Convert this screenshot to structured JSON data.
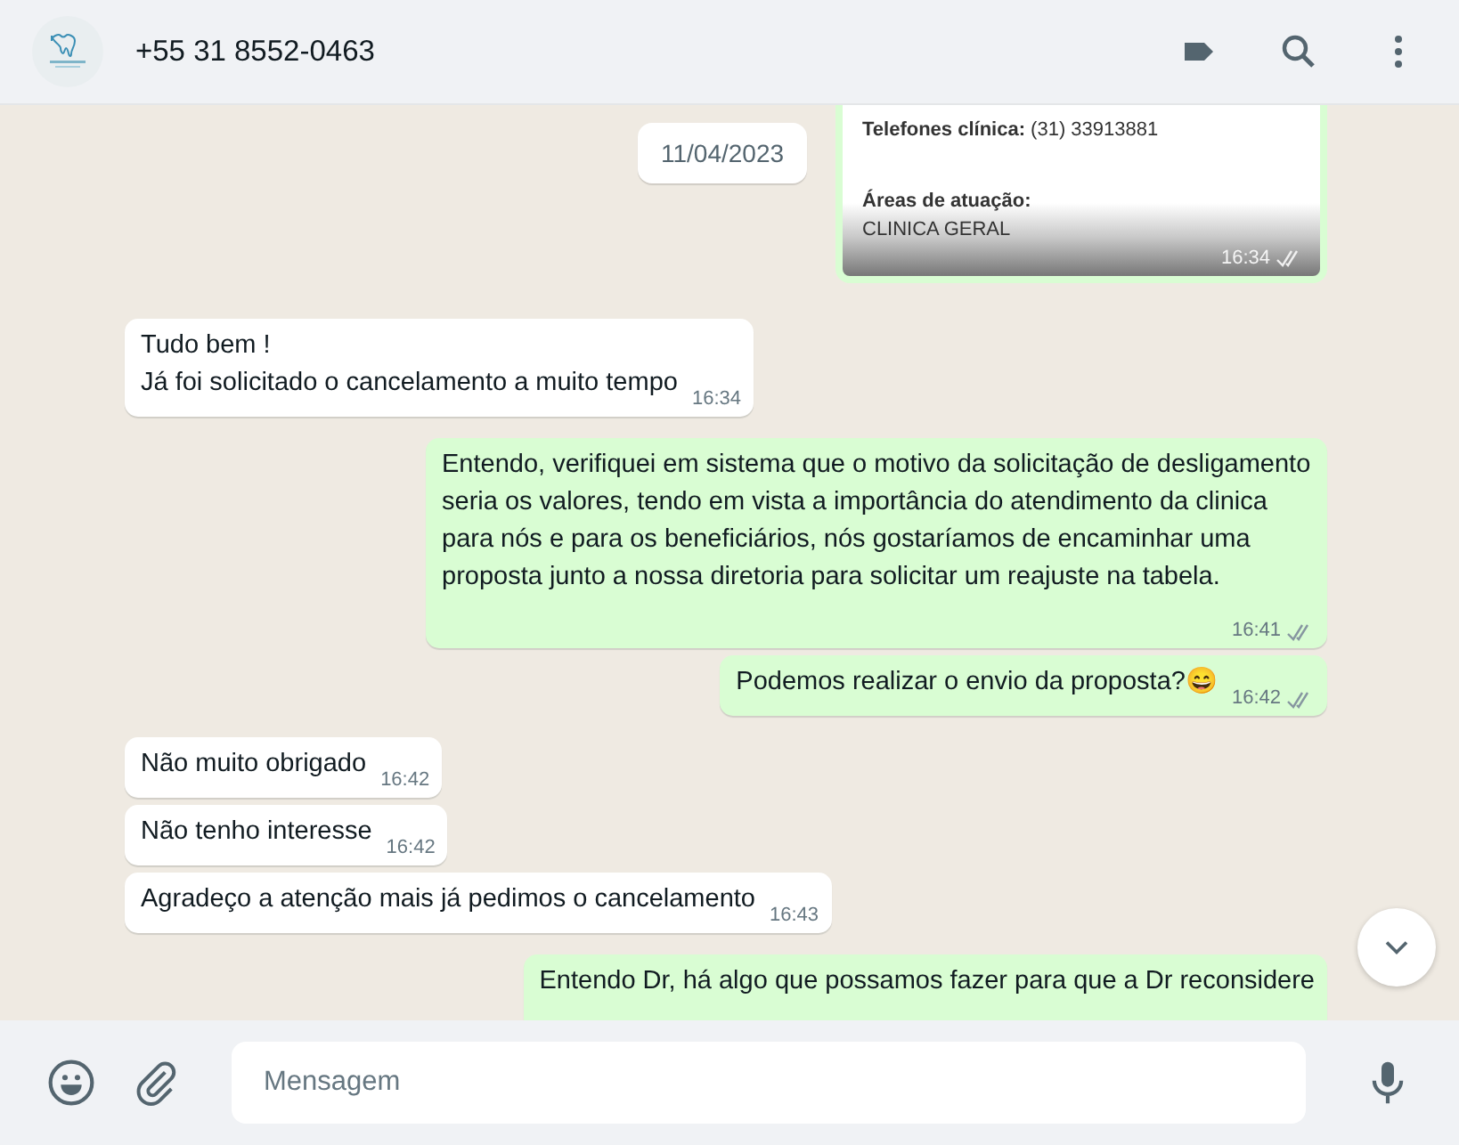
{
  "header": {
    "contact": "+55 31 8552-0463"
  },
  "date_chip": "11/04/2023",
  "messages": [
    {
      "kind": "card",
      "outgoing": true,
      "phone": "**Telefones clínica:** (31) 33913881",
      "areas_label": "Áreas de atuação:",
      "areas": "CLINICA GERAL",
      "time": "16:34",
      "read": false
    },
    {
      "kind": "text",
      "outgoing": false,
      "text": "Tudo bem !\nJá foi solicitado o cancelamento a muito tempo",
      "time": "16:34"
    },
    {
      "kind": "text",
      "outgoing": true,
      "text": "Entendo, verifiquei em sistema que o motivo da solicitação de desligamento seria os valores, tendo em vista a importância do atendimento da clinica para nós e para os beneficiários, nós gostaríamos de encaminhar uma proposta junto a nossa diretoria para solicitar um reajuste na tabela.",
      "time": "16:41",
      "read": false
    },
    {
      "kind": "text",
      "outgoing": true,
      "text": "Podemos realizar o envio da proposta?😄",
      "time": "16:42",
      "read": false
    },
    {
      "kind": "text",
      "outgoing": false,
      "text": "Não muito obrigado",
      "time": "16:42"
    },
    {
      "kind": "text",
      "outgoing": false,
      "text": "Não tenho interesse",
      "time": "16:42"
    },
    {
      "kind": "text",
      "outgoing": false,
      "text": "Agradeço a atenção mais já pedimos o cancelamento",
      "time": "16:43"
    },
    {
      "kind": "partial",
      "outgoing": true,
      "text": "Entendo Dr, há algo que possamos fazer para que a Dr reconsidere"
    }
  ],
  "composer": {
    "placeholder": "Mensagem"
  }
}
